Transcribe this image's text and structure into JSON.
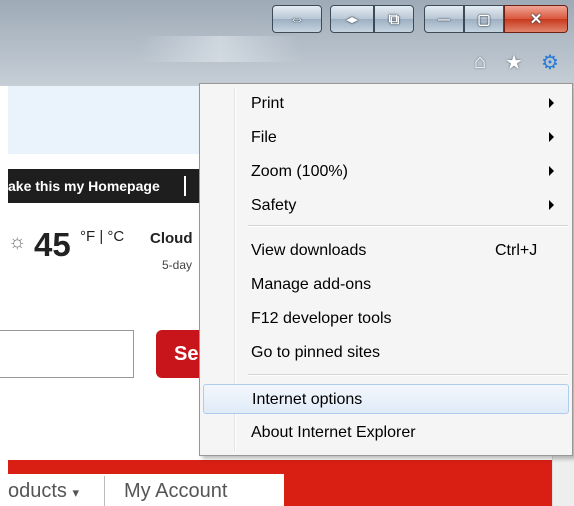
{
  "window": {
    "buttons": [
      "⇔",
      "◂▸",
      "⧉",
      "—",
      "▢",
      "✕"
    ]
  },
  "page": {
    "homepage_link": "ake this my Homepage",
    "weather": {
      "temperature": "45",
      "units": "°F | °C",
      "condition": "Cloud",
      "forecast": "5-day"
    },
    "search_button_label": "Se",
    "nav": {
      "products": "oducts",
      "caret": "▾",
      "account": "My Account"
    }
  },
  "menu": {
    "items": [
      {
        "label": "Print",
        "shortcut": "",
        "submenu": true
      },
      {
        "label": "File",
        "shortcut": "",
        "submenu": true
      },
      {
        "label": "Zoom (100%)",
        "shortcut": "",
        "submenu": true
      },
      {
        "label": "Safety",
        "shortcut": "",
        "submenu": true
      },
      {
        "label": "View downloads",
        "shortcut": "Ctrl+J",
        "submenu": false
      },
      {
        "label": "Manage add-ons",
        "shortcut": "",
        "submenu": false
      },
      {
        "label": "F12 developer tools",
        "shortcut": "",
        "submenu": false
      },
      {
        "label": "Go to pinned sites",
        "shortcut": "",
        "submenu": false
      },
      {
        "label": "Internet options",
        "shortcut": "",
        "submenu": false,
        "highlighted": true
      },
      {
        "label": "About Internet Explorer",
        "shortcut": "",
        "submenu": false
      }
    ]
  },
  "icons": {
    "home": "home-icon",
    "favorites": "star-icon",
    "tools": "gear-icon"
  },
  "colors": {
    "accent_red": "#d91f14",
    "tools_blue": "#2a7ad5",
    "menu_highlight": "#e0ebf8"
  }
}
